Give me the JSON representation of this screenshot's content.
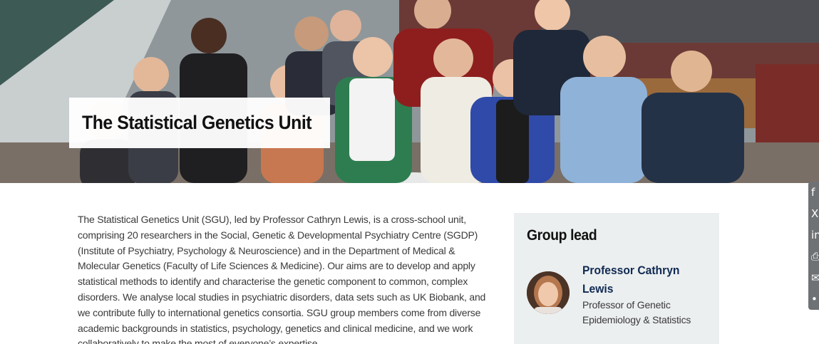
{
  "hero": {
    "title": "The Statistical Genetics Unit"
  },
  "intro": {
    "text": "The Statistical Genetics Unit (SGU), led by Professor Cathryn Lewis, is a cross-school unit, comprising 20 researchers in the Social, Genetic & Developmental Psychiatry Centre (SGDP) (Institute of Psychiatry, Psychology & Neuroscience) and in the Department of Medical & Molecular Genetics (Faculty of Life Sciences & Medicine). Our aims are to develop and apply statistical methods to identify and characterise the genetic component to common, complex disorders. We analyse local studies in psychiatric disorders, data sets such as UK Biobank, and we contribute fully to international genetics consortia. SGU group members come from diverse academic backgrounds in statistics, psychology, genetics and clinical medicine, and we work collaboratively to make the most of everyone’s expertise."
  },
  "group_lead": {
    "heading": "Group lead",
    "name": "Professor Cathryn Lewis",
    "role": "Professor of Genetic Epidemiology & Statistics"
  },
  "share": {
    "icons": [
      "facebook-icon",
      "x-icon",
      "linkedin-icon",
      "print-icon",
      "email-icon",
      "more-icon"
    ]
  },
  "colors": {
    "lead_name": "#102a52",
    "card_bg": "#eceff0",
    "share_bar": "#6f7275"
  }
}
